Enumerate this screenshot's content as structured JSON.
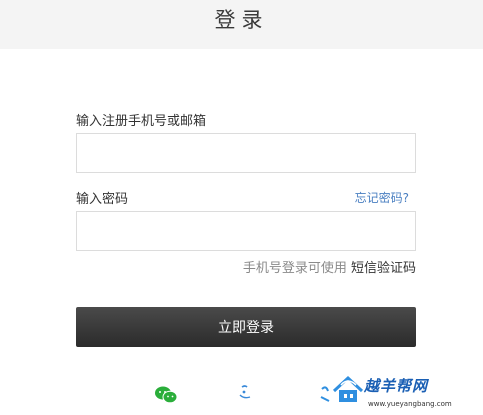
{
  "header": {
    "title": "登录"
  },
  "form": {
    "account_label": "输入注册手机号或邮箱",
    "account_value": "",
    "password_label": "输入密码",
    "password_value": "",
    "forgot_link": "忘记密码?",
    "alt_login_text": "手机号登录可使用",
    "alt_login_link": "短信验证码",
    "submit_label": "立即登录"
  },
  "social": {
    "icons": [
      "wechat-icon",
      "weibo-icon",
      "qq-icon"
    ],
    "colors": {
      "wechat": "#2aae3a",
      "weibo": "#3a8ad9",
      "qq": "#2f8fe0"
    }
  },
  "watermark": {
    "name": "越羊帮网",
    "url": "www.yueyangbang.com"
  },
  "colors": {
    "header_bg": "#f4f4f4",
    "button_bg": "#333333",
    "link": "#4a7fc1"
  }
}
